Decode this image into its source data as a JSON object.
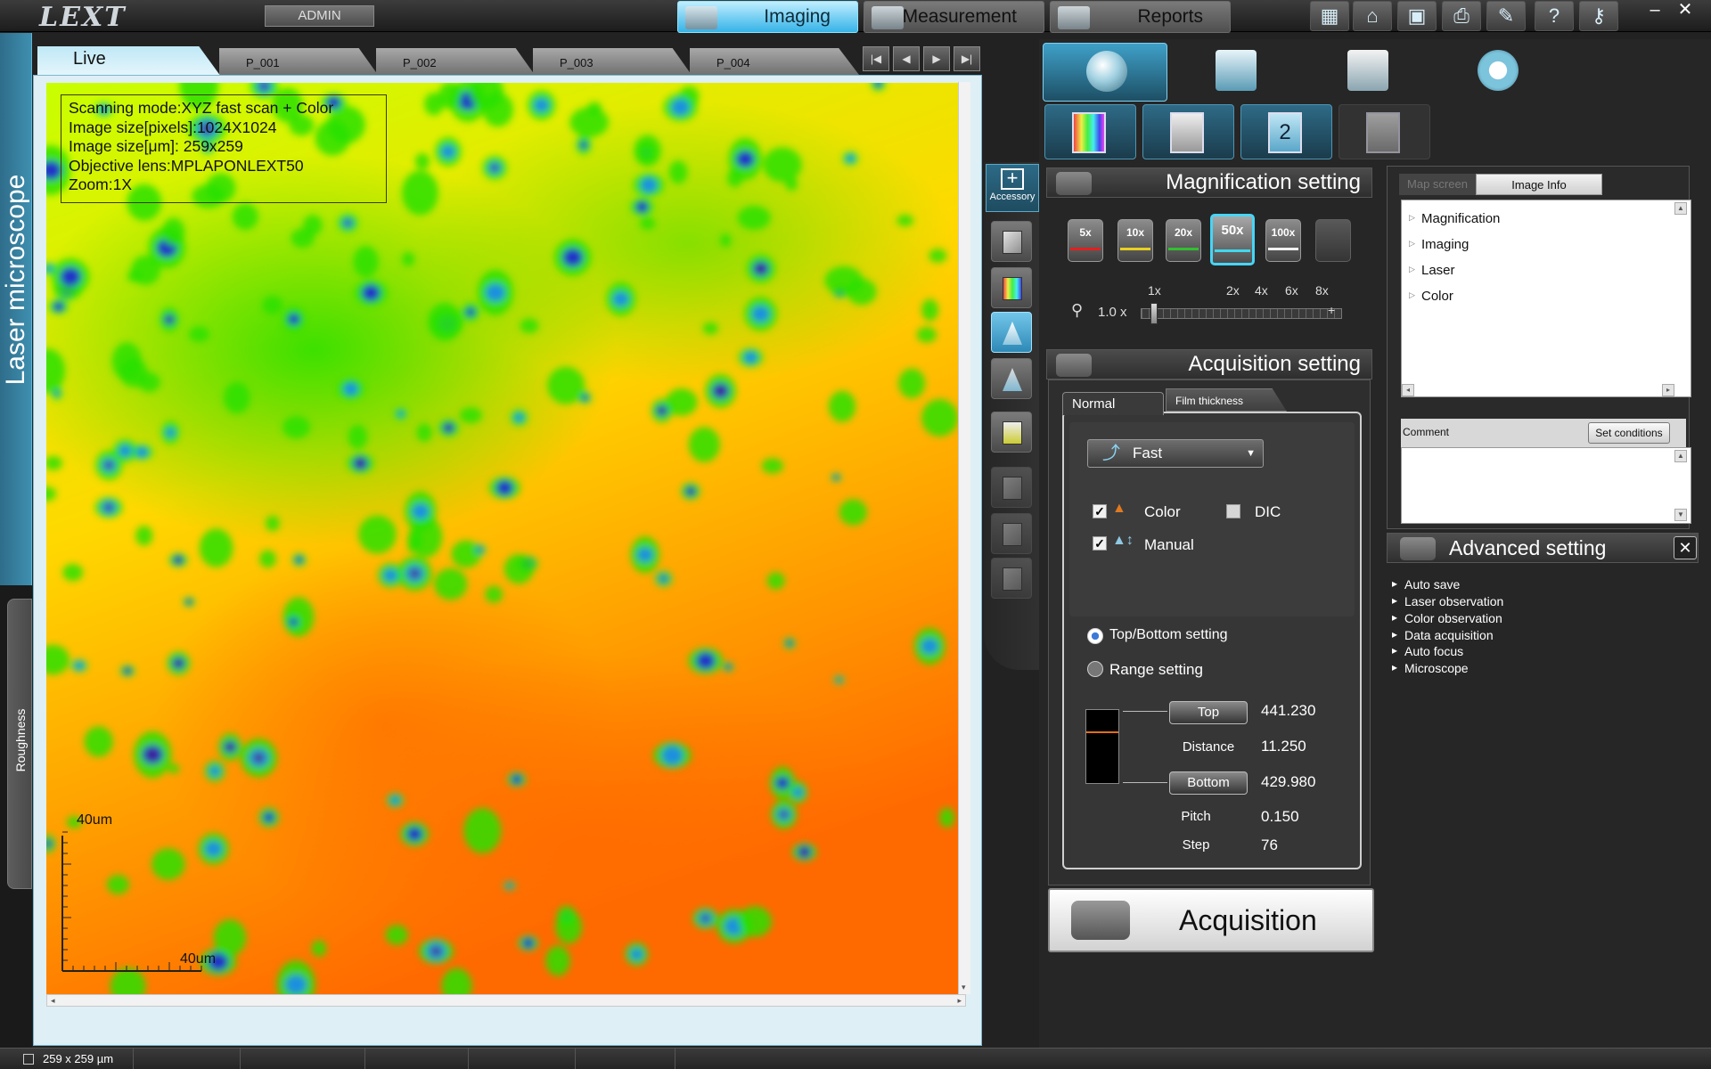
{
  "app": {
    "logo": "LEXT",
    "user": "ADMIN",
    "modes": [
      {
        "label": "Imaging",
        "active": true
      },
      {
        "label": "Measurement",
        "active": false
      },
      {
        "label": "Reports",
        "active": false
      }
    ],
    "toolbar_icons": [
      "calendar-icon",
      "folder-open-icon",
      "save-icon",
      "print-icon",
      "wrench-icon",
      "help-icon",
      "key-icon"
    ],
    "window": {
      "minimize": "–",
      "close": "✕"
    }
  },
  "left_tabs": {
    "laser": "Laser microscope",
    "roughness": "Roughness"
  },
  "image_tabs": [
    "Live",
    "P_001",
    "P_002",
    "P_003",
    "P_004"
  ],
  "nav_buttons": [
    "|◀",
    "◀",
    "▶",
    "▶|"
  ],
  "image_panel": {
    "scan_info": [
      "Scanning mode:XYZ fast scan + Color",
      "Image size[pixels]:1024X1024",
      "Image size[μm]: 259x259",
      "Objective lens:MPLAPONLEXT50",
      "Zoom:1X"
    ],
    "scale_y": "40um",
    "scale_x": "40um",
    "colormap": [
      "#ff6a00",
      "#ffd800",
      "#c8ff00",
      "#28e000",
      "#1b8fe0",
      "#2030c8",
      "#4a1a7a"
    ]
  },
  "side_tools": {
    "accessory_label": "Accessory"
  },
  "control": {
    "magnification": {
      "title": "Magnification setting",
      "lenses": [
        {
          "label": "5x",
          "color": "#e02020"
        },
        {
          "label": "10x",
          "color": "#e8d020"
        },
        {
          "label": "20x",
          "color": "#30c030"
        },
        {
          "label": "50x",
          "color": "#40d8f0"
        },
        {
          "label": "100x",
          "color": "#f0f0f0"
        },
        {
          "label": "",
          "color": "#777777"
        }
      ],
      "selected": "50x",
      "zoom_value": "1.0",
      "zoom_unit": "x",
      "zoom_ticks": [
        "1x",
        "2x",
        "4x",
        "6x",
        "8x"
      ],
      "zoom_level": 1.0
    },
    "acquisition": {
      "title": "Acquisition setting",
      "tabs": [
        "Normal",
        "Film thickness"
      ],
      "mode": "Fast",
      "color_checked": true,
      "color_label": "Color",
      "dic_checked": false,
      "dic_label": "DIC",
      "manual_checked": true,
      "manual_label": "Manual",
      "radio_options": [
        {
          "label": "Top/Bottom setting",
          "selected": true
        },
        {
          "label": "Range setting",
          "selected": false
        }
      ],
      "top_button": "Top",
      "top_value": "441.230",
      "distance_label": "Distance",
      "distance_value": "11.250",
      "bottom_button": "Bottom",
      "bottom_value": "429.980",
      "pitch_label": "Pitch",
      "pitch_value": "0.150",
      "step_label": "Step",
      "step_value": "76"
    },
    "acquisition_button": "Acquisition"
  },
  "info_panel": {
    "tabs": [
      "Map screen",
      "Image Info"
    ],
    "tree": [
      "Magnification",
      "Imaging",
      "Laser",
      "Color"
    ],
    "comment_label": "Comment",
    "set_conditions": "Set conditions"
  },
  "advanced": {
    "title": "Advanced setting",
    "items": [
      "Auto save",
      "Laser observation",
      "Color observation",
      "Data acquisition",
      "Auto focus",
      "Microscope"
    ]
  },
  "status": {
    "size": "259 x 259 µm"
  }
}
